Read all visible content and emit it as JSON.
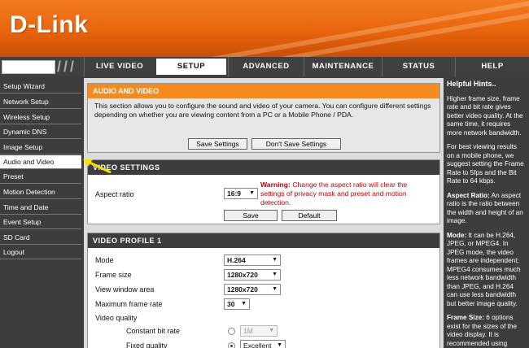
{
  "brand": {
    "logo_text": "D-Link"
  },
  "nav": {
    "tabs": [
      {
        "label": "LIVE VIDEO"
      },
      {
        "label": "SETUP"
      },
      {
        "label": "ADVANCED"
      },
      {
        "label": "MAINTENANCE"
      },
      {
        "label": "STATUS"
      },
      {
        "label": "HELP"
      }
    ],
    "active_tab": "SETUP"
  },
  "sidebar": {
    "items": [
      {
        "label": "Setup Wizard"
      },
      {
        "label": "Network Setup"
      },
      {
        "label": "Wireless Setup"
      },
      {
        "label": "Dynamic DNS"
      },
      {
        "label": "Image Setup"
      },
      {
        "label": "Audio and Video"
      },
      {
        "label": "Preset"
      },
      {
        "label": "Motion Detection"
      },
      {
        "label": "Time and Date"
      },
      {
        "label": "Event Setup"
      },
      {
        "label": "SD Card"
      },
      {
        "label": "Logout"
      }
    ],
    "active_item": "Audio and Video"
  },
  "audio_video": {
    "title": "AUDIO AND VIDEO",
    "description": "This section allows you to configure the sound and video of your camera. You can configure different settings depending on whether you are viewing content from a PC or a Mobile Phone / PDA.",
    "save_label": "Save Settings",
    "dont_save_label": "Don't Save Settings"
  },
  "video_settings": {
    "title": "VIDEO SETTINGS",
    "aspect_ratio_label": "Aspect ratio",
    "aspect_ratio_value": "16:9",
    "warning_label": "Warning:",
    "warning_text": "Change the aspect ratio will clear the settings of privacy mask and preset and motion detection.",
    "save_label": "Save",
    "default_label": "Default"
  },
  "video_profile": {
    "title": "VIDEO PROFILE 1",
    "mode_label": "Mode",
    "mode_value": "H.264",
    "frame_size_label": "Frame size",
    "frame_size_value": "1280x720",
    "view_window_label": "View window area",
    "view_window_value": "1280x720",
    "max_frame_rate_label": "Maximum frame rate",
    "max_frame_rate_value": "30",
    "video_quality_label": "Video quality",
    "constant_bit_rate_label": "Constant bit rate",
    "constant_bit_rate_value": "1M",
    "fixed_quality_label": "Fixed quality",
    "fixed_quality_value": "Excellent"
  },
  "hints": {
    "title": "Helpful Hints..",
    "p1": "Higher frame size, frame rate and bit rate gives better video quality. At the same time, it requires more network bandwidth.",
    "p2": "For best viewing results on a mobile phone, we suggest setting the Frame Rate to 5fps and the Bit Rate to 64 kbps.",
    "aspect_title": "Aspect Ratio:",
    "aspect_text": "An aspect ratio is the ratio between the width and height of an image.",
    "mode_title": "Mode:",
    "mode_text": "It can be H.264, JPEG, or MPEG4. In JPEG mode, the video frames are independent; MPEG4 consumes much less network bandwidth than JPEG, and H.264 can use less bandwidth but better image quality.",
    "frame_title": "Frame Size:",
    "frame_text": "6 options exist for the sizes of the video display. It is recommended using"
  },
  "colors": {
    "accent_orange": "#f58a1f",
    "banner_orange": "#e8650e",
    "dark_bar": "#3d3d3d",
    "warning_red": "#c00000"
  }
}
